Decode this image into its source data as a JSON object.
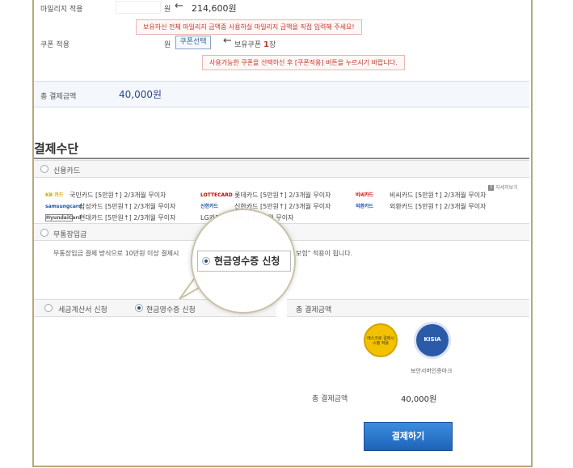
{
  "mileage": {
    "label": "마일리지 적용",
    "unit": "원",
    "arrow": "←",
    "amount": "214,600원",
    "notice": "보유하신 전체 마일리지 금액중 사용하실 마일리지 금액을 직접 입력해 주세요!"
  },
  "coupon": {
    "label": "쿠폰 적용",
    "unit": "원",
    "button": "쿠폰선택",
    "arrow": "←",
    "owned_prefix": "보유쿠폰",
    "owned_count": "1",
    "owned_suffix": "장",
    "notice": "사용가능한 쿠폰을 선택하신 후 [쿠폰적용] 버튼을 누르시기 바랍니다."
  },
  "total_top": {
    "label": "총 결제금액",
    "amount": "40,000원"
  },
  "payment": {
    "title": "결제수단",
    "credit_label": "신용카드",
    "info_link": "자세히보기",
    "cards": [
      [
        "국민카드 [5만원↑] 2/3개월 무이자",
        "롯데카드 [5만원↑] 2/3개월 무이자",
        "비씨카드 [5만원↑] 2/3개월 무이자"
      ],
      [
        "삼성카드 [5만원↑] 2/3개월 무이자",
        "신한카드 [5만원↑] 2/3개월 무이자",
        "외환카드 [5만원↑] 2/3개월 무이자"
      ],
      [
        "현대카드 [5만원↑] 2/3개월 무이자",
        "LG카드 [5만원↑] 2/3개월 무이자"
      ]
    ],
    "card_logos": [
      "KB 카드",
      "LOTTECARD",
      "비씨카드",
      "samsungcard",
      "신한카드",
      "외환카드",
      "HyundaiCard"
    ],
    "bank_label": "무통장입금",
    "bank_note": "무통장입금 결제 방식으로 10만원 이상 결제시",
    "bank_note_suffix": "보험\" 적용이 됩니다."
  },
  "bubble": {
    "label": "현금영수증 신청"
  },
  "receipt": {
    "tax_invoice": "세금계산서 신청",
    "cash_receipt": "현금영수증 신청"
  },
  "summary": {
    "header": "총 결제금액",
    "badge1": "에스크로 결제시스템 적용",
    "badge2": "KISIA",
    "badge_caption": "보안서버인증마크",
    "total_label": "총 결제금액",
    "total_amount": "40,000원",
    "pay_button": "결제하기"
  }
}
